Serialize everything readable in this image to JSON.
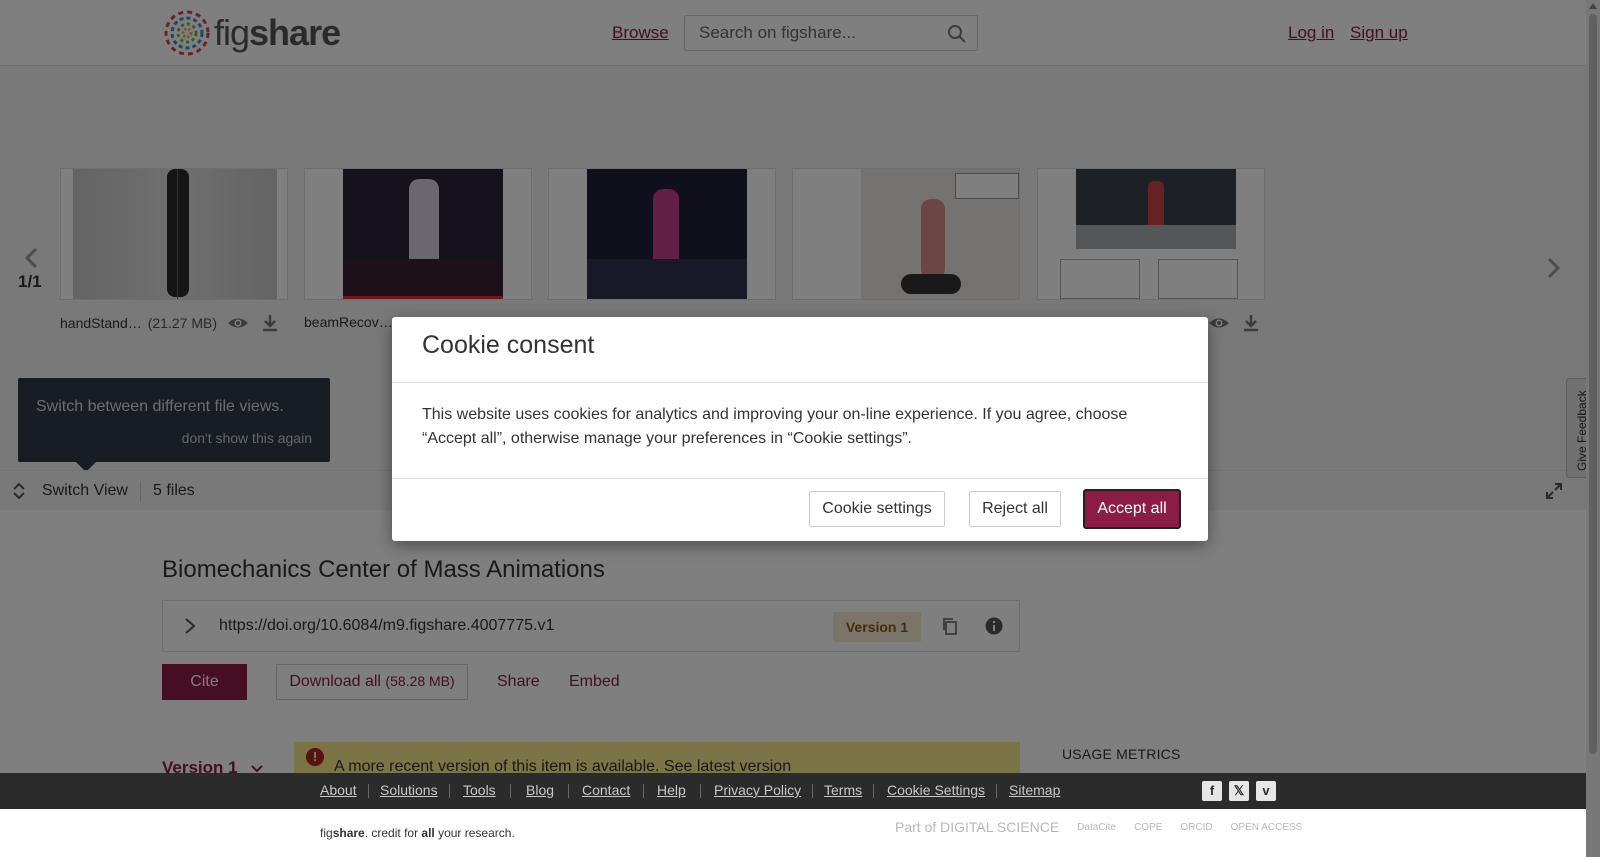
{
  "header": {
    "logo_text_light": "fig",
    "logo_text_bold": "share",
    "browse": "Browse",
    "search_placeholder": "Search on figshare...",
    "login": "Log in",
    "signup": "Sign up"
  },
  "viewer": {
    "pager": "1/1",
    "files": [
      {
        "name": "handStand…",
        "size": "(21.27 MB)"
      },
      {
        "name": "beamRecov…",
        "size": ""
      },
      {
        "name": "",
        "size": ""
      },
      {
        "name": "",
        "size": ""
      },
      {
        "name": "",
        "size": ""
      }
    ],
    "tooltip_text": "Switch between different file views.",
    "tooltip_dismiss": "don't show this again",
    "switch_view": "Switch View",
    "files_count": "5 files",
    "feedback": "Give Feedback"
  },
  "item": {
    "title": "Biomechanics Center of Mass Animations",
    "doi": "https://doi.org/10.6084/m9.figshare.4007775.v1",
    "version_badge": "Version 1",
    "cite": "Cite",
    "download_label": "Download all",
    "download_size": "(58.28 MB)",
    "share": "Share",
    "embed": "Embed",
    "version_select": "Version 1",
    "alert_icon": "!",
    "alert_text": "A more recent version of this item is available. See latest version",
    "usage_metrics": "USAGE METRICS"
  },
  "footer": {
    "links": [
      "About",
      "Solutions",
      "Tools",
      "Blog",
      "Contact",
      "Help",
      "Privacy Policy",
      "Terms",
      "Cookie Settings",
      "Sitemap"
    ],
    "tag_pre": "fig",
    "tag_bold": "share",
    "tag_mid": ". credit for ",
    "tag_all": "all",
    "tag_end": " your research.",
    "partners": [
      "Part of DIGITAL SCIENCE",
      "DataCite",
      "COPE",
      "ORCID",
      "OPEN ACCESS"
    ]
  },
  "cookie_modal": {
    "title": "Cookie consent",
    "text": "This website uses cookies for analytics and improving your on-line experience. If you agree, choose “Accept all”, otherwise manage your preferences in “Cookie settings”.",
    "settings": "Cookie settings",
    "reject": "Reject all",
    "accept": "Accept all"
  },
  "colors": {
    "brand": "#8b1c44",
    "tooltip_bg": "#2f3a46",
    "alert_bg": "#f4e98e",
    "footer_bg": "#2b2b2b"
  }
}
